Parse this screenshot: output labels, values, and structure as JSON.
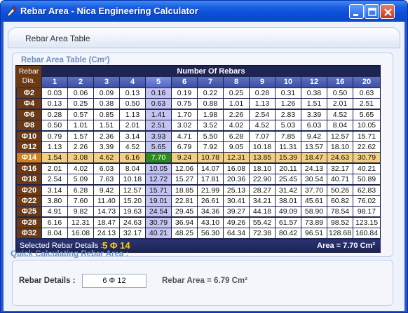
{
  "window": {
    "title": "Rebar Area - Nica Engineering Calculator"
  },
  "header": {
    "title": "Rebar Area Table"
  },
  "table_group": {
    "title": "Rebar Area Table (Cm²)"
  },
  "table": {
    "corner_label_1": "Rebar",
    "corner_label_2": "Dia.",
    "number_of_rebars_header": "Number Of Rebars",
    "columns": [
      "1",
      "2",
      "3",
      "4",
      "5",
      "6",
      "7",
      "8",
      "9",
      "10",
      "12",
      "16",
      "20"
    ],
    "rows": [
      {
        "label": "Φ2",
        "values": [
          "0.03",
          "0.06",
          "0.09",
          "0.13",
          "0.16",
          "0.19",
          "0.22",
          "0.25",
          "0.28",
          "0.31",
          "0.38",
          "0.50",
          "0.63"
        ]
      },
      {
        "label": "Φ4",
        "values": [
          "0.13",
          "0.25",
          "0.38",
          "0.50",
          "0.63",
          "0.75",
          "0.88",
          "1.01",
          "1.13",
          "1.26",
          "1.51",
          "2.01",
          "2.51"
        ]
      },
      {
        "label": "Φ6",
        "values": [
          "0.28",
          "0.57",
          "0.85",
          "1.13",
          "1.41",
          "1.70",
          "1.98",
          "2.26",
          "2.54",
          "2.83",
          "3.39",
          "4.52",
          "5.65"
        ]
      },
      {
        "label": "Φ8",
        "values": [
          "0.50",
          "1.01",
          "1.51",
          "2.01",
          "2.51",
          "3.02",
          "3.52",
          "4.02",
          "4.52",
          "5.03",
          "6.03",
          "8.04",
          "10.05"
        ]
      },
      {
        "label": "Φ10",
        "values": [
          "0.79",
          "1.57",
          "2.36",
          "3.14",
          "3.93",
          "4.71",
          "5.50",
          "6.28",
          "7.07",
          "7.85",
          "9.42",
          "12.57",
          "15.71"
        ]
      },
      {
        "label": "Φ12",
        "values": [
          "1.13",
          "2.26",
          "3.39",
          "4.52",
          "5.65",
          "6.79",
          "7.92",
          "9.05",
          "10.18",
          "11.31",
          "13.57",
          "18.10",
          "22.62"
        ]
      },
      {
        "label": "Φ14",
        "values": [
          "1.54",
          "3.08",
          "4.62",
          "6.16",
          "7.70",
          "9.24",
          "10.78",
          "12.31",
          "13.85",
          "15.39",
          "18.47",
          "24.63",
          "30.79"
        ]
      },
      {
        "label": "Φ16",
        "values": [
          "2.01",
          "4.02",
          "6.03",
          "8.04",
          "10.05",
          "12.06",
          "14.07",
          "16.08",
          "18.10",
          "20.11",
          "24.13",
          "32.17",
          "40.21"
        ]
      },
      {
        "label": "Φ18",
        "values": [
          "2.54",
          "5.09",
          "7.63",
          "10.18",
          "12.72",
          "15.27",
          "17.81",
          "20.36",
          "22.90",
          "25.45",
          "30.54",
          "40.71",
          "50.89"
        ]
      },
      {
        "label": "Φ20",
        "values": [
          "3.14",
          "6.28",
          "9.42",
          "12.57",
          "15.71",
          "18.85",
          "21.99",
          "25.13",
          "28.27",
          "31.42",
          "37.70",
          "50.26",
          "62.83"
        ]
      },
      {
        "label": "Φ22",
        "values": [
          "3.80",
          "7.60",
          "11.40",
          "15.20",
          "19.01",
          "22.81",
          "26.61",
          "30.41",
          "34.21",
          "38.01",
          "45.61",
          "60.82",
          "76.02"
        ]
      },
      {
        "label": "Φ25",
        "values": [
          "4.91",
          "9.82",
          "14.73",
          "19.63",
          "24.54",
          "29.45",
          "34.36",
          "39.27",
          "44.18",
          "49.09",
          "58.90",
          "78.54",
          "98.17"
        ]
      },
      {
        "label": "Φ28",
        "values": [
          "6.16",
          "12.31",
          "18.47",
          "24.63",
          "30.79",
          "36.94",
          "43.10",
          "49.26",
          "55.42",
          "61.57",
          "73.89",
          "98.52",
          "123.15"
        ]
      },
      {
        "label": "Φ32",
        "values": [
          "8.04",
          "16.08",
          "24.13",
          "32.17",
          "40.21",
          "48.25",
          "56.30",
          "64.34",
          "72.38",
          "80.42",
          "96.51",
          "128.68",
          "160.84"
        ]
      }
    ],
    "selected_row_index": 6,
    "selected_col_index": 4
  },
  "status": {
    "selected_label": "Selected Rebar Details :",
    "selected_value": "5 Φ 14",
    "area_text": "Area = 7.70 Cm²"
  },
  "quick": {
    "title": "Quick Calculating Rebar Area :",
    "details_label": "Rebar Details :",
    "details_value": "6 Φ 12",
    "area_text": "Rebar Area = 6.79 Cm²"
  },
  "colors": {
    "row_header": "#6b3a14",
    "selected_row_header": "#d57e16",
    "column_highlight": "#c4c4f3",
    "row_highlight": "#f4cf7f",
    "selected_cell": "#2e8b1a",
    "accent_yellow": "#ffd200"
  },
  "icons": [
    "app-icon",
    "minimize-icon",
    "maximize-icon",
    "close-icon"
  ]
}
